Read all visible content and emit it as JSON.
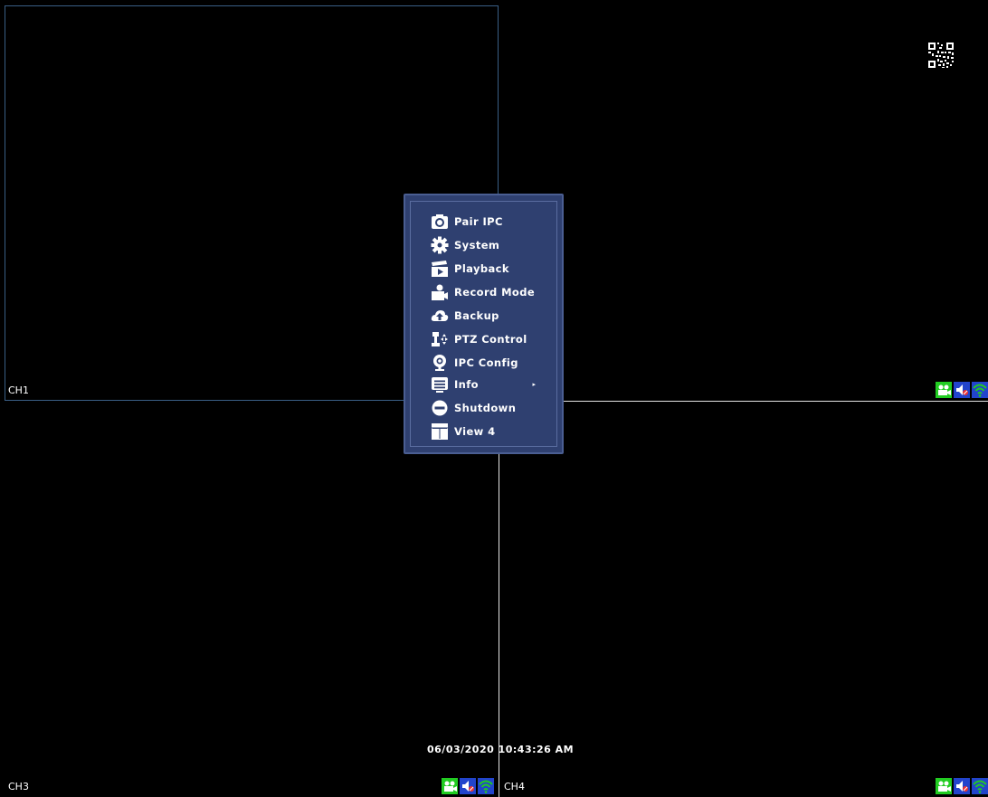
{
  "channels": {
    "ch1": {
      "label": "CH1"
    },
    "ch2": {
      "label": ""
    },
    "ch3": {
      "label": "CH3"
    },
    "ch4": {
      "label": "CH4"
    }
  },
  "datetime": "06/03/2020 10:43:26 AM",
  "menu": {
    "items": [
      {
        "label": "Pair IPC",
        "icon": "camera-icon"
      },
      {
        "label": "System",
        "icon": "gear-icon"
      },
      {
        "label": "Playback",
        "icon": "clapperboard-icon"
      },
      {
        "label": "Record Mode",
        "icon": "video-camera-icon"
      },
      {
        "label": "Backup",
        "icon": "cloud-upload-icon"
      },
      {
        "label": "PTZ Control",
        "icon": "ptz-icon"
      },
      {
        "label": "IPC Config",
        "icon": "webcam-icon"
      },
      {
        "label": "Info",
        "icon": "info-list-icon",
        "submenu_arrow": "▸"
      },
      {
        "label": "Shutdown",
        "icon": "shutdown-icon"
      },
      {
        "label": "View 4",
        "icon": "grid-view-icon"
      }
    ]
  },
  "status_icons": [
    "record-icon",
    "mute-icon",
    "wifi-signal-icon"
  ],
  "colors": {
    "menu_bg": "#2f4070",
    "status_green": "#22cc22",
    "status_blue": "#2244cc",
    "active_pane_border": "#3a5f86"
  }
}
